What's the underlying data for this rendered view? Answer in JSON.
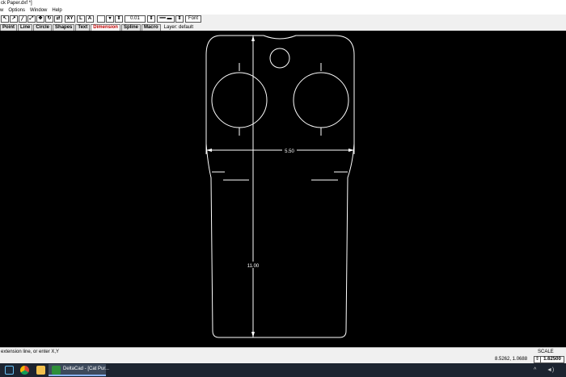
{
  "window": {
    "title": "ck Paper.dxf *]"
  },
  "menu": [
    "w",
    "Options",
    "Window",
    "Help"
  ],
  "toolbar": {
    "line_width_value": "0.01",
    "font_label": "Font",
    "bold_label": "B",
    "xy_label": "XY",
    "text_L": "L",
    "text_A": "A"
  },
  "tabs": [
    {
      "label": "Point",
      "active": false
    },
    {
      "label": "Line",
      "active": false
    },
    {
      "label": "Circle",
      "active": false
    },
    {
      "label": "Shapes",
      "active": false
    },
    {
      "label": "Text",
      "active": false
    },
    {
      "label": "Dimension",
      "active": true
    },
    {
      "label": "Spline",
      "active": false
    },
    {
      "label": "Macro",
      "active": false
    }
  ],
  "layer": "Layer: default",
  "drawing": {
    "dim_width": "5.50",
    "dim_height": "11.00",
    "line_color": "#ffffff",
    "background_color": "#000000"
  },
  "status": {
    "prompt": "extension line, or enter X,Y",
    "coords": "8.5262, 1.0688",
    "scale_label": "SCALE",
    "scale_value": "1.62500"
  },
  "taskbar": {
    "app_label": "DeltaCad - [Cat Pur...",
    "icons": [
      "steam-icon",
      "chrome-icon",
      "file-explorer-icon",
      "deltacad-icon"
    ]
  },
  "colors": {
    "active_tab": "#c00000",
    "taskbar": "#1c2430"
  }
}
